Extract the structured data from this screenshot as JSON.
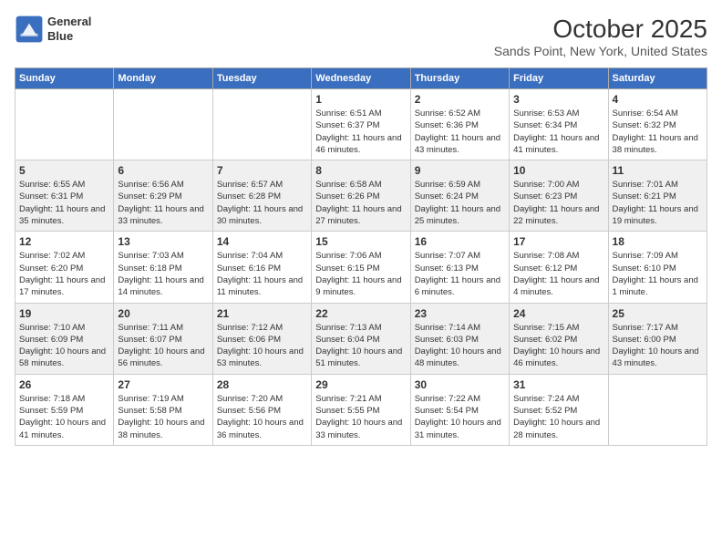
{
  "header": {
    "logo": {
      "line1": "General",
      "line2": "Blue"
    },
    "month": "October 2025",
    "location": "Sands Point, New York, United States"
  },
  "weekdays": [
    "Sunday",
    "Monday",
    "Tuesday",
    "Wednesday",
    "Thursday",
    "Friday",
    "Saturday"
  ],
  "weeks": [
    [
      {
        "day": "",
        "content": ""
      },
      {
        "day": "",
        "content": ""
      },
      {
        "day": "",
        "content": ""
      },
      {
        "day": "1",
        "content": "Sunrise: 6:51 AM\nSunset: 6:37 PM\nDaylight: 11 hours and 46 minutes."
      },
      {
        "day": "2",
        "content": "Sunrise: 6:52 AM\nSunset: 6:36 PM\nDaylight: 11 hours and 43 minutes."
      },
      {
        "day": "3",
        "content": "Sunrise: 6:53 AM\nSunset: 6:34 PM\nDaylight: 11 hours and 41 minutes."
      },
      {
        "day": "4",
        "content": "Sunrise: 6:54 AM\nSunset: 6:32 PM\nDaylight: 11 hours and 38 minutes."
      }
    ],
    [
      {
        "day": "5",
        "content": "Sunrise: 6:55 AM\nSunset: 6:31 PM\nDaylight: 11 hours and 35 minutes."
      },
      {
        "day": "6",
        "content": "Sunrise: 6:56 AM\nSunset: 6:29 PM\nDaylight: 11 hours and 33 minutes."
      },
      {
        "day": "7",
        "content": "Sunrise: 6:57 AM\nSunset: 6:28 PM\nDaylight: 11 hours and 30 minutes."
      },
      {
        "day": "8",
        "content": "Sunrise: 6:58 AM\nSunset: 6:26 PM\nDaylight: 11 hours and 27 minutes."
      },
      {
        "day": "9",
        "content": "Sunrise: 6:59 AM\nSunset: 6:24 PM\nDaylight: 11 hours and 25 minutes."
      },
      {
        "day": "10",
        "content": "Sunrise: 7:00 AM\nSunset: 6:23 PM\nDaylight: 11 hours and 22 minutes."
      },
      {
        "day": "11",
        "content": "Sunrise: 7:01 AM\nSunset: 6:21 PM\nDaylight: 11 hours and 19 minutes."
      }
    ],
    [
      {
        "day": "12",
        "content": "Sunrise: 7:02 AM\nSunset: 6:20 PM\nDaylight: 11 hours and 17 minutes."
      },
      {
        "day": "13",
        "content": "Sunrise: 7:03 AM\nSunset: 6:18 PM\nDaylight: 11 hours and 14 minutes."
      },
      {
        "day": "14",
        "content": "Sunrise: 7:04 AM\nSunset: 6:16 PM\nDaylight: 11 hours and 11 minutes."
      },
      {
        "day": "15",
        "content": "Sunrise: 7:06 AM\nSunset: 6:15 PM\nDaylight: 11 hours and 9 minutes."
      },
      {
        "day": "16",
        "content": "Sunrise: 7:07 AM\nSunset: 6:13 PM\nDaylight: 11 hours and 6 minutes."
      },
      {
        "day": "17",
        "content": "Sunrise: 7:08 AM\nSunset: 6:12 PM\nDaylight: 11 hours and 4 minutes."
      },
      {
        "day": "18",
        "content": "Sunrise: 7:09 AM\nSunset: 6:10 PM\nDaylight: 11 hours and 1 minute."
      }
    ],
    [
      {
        "day": "19",
        "content": "Sunrise: 7:10 AM\nSunset: 6:09 PM\nDaylight: 10 hours and 58 minutes."
      },
      {
        "day": "20",
        "content": "Sunrise: 7:11 AM\nSunset: 6:07 PM\nDaylight: 10 hours and 56 minutes."
      },
      {
        "day": "21",
        "content": "Sunrise: 7:12 AM\nSunset: 6:06 PM\nDaylight: 10 hours and 53 minutes."
      },
      {
        "day": "22",
        "content": "Sunrise: 7:13 AM\nSunset: 6:04 PM\nDaylight: 10 hours and 51 minutes."
      },
      {
        "day": "23",
        "content": "Sunrise: 7:14 AM\nSunset: 6:03 PM\nDaylight: 10 hours and 48 minutes."
      },
      {
        "day": "24",
        "content": "Sunrise: 7:15 AM\nSunset: 6:02 PM\nDaylight: 10 hours and 46 minutes."
      },
      {
        "day": "25",
        "content": "Sunrise: 7:17 AM\nSunset: 6:00 PM\nDaylight: 10 hours and 43 minutes."
      }
    ],
    [
      {
        "day": "26",
        "content": "Sunrise: 7:18 AM\nSunset: 5:59 PM\nDaylight: 10 hours and 41 minutes."
      },
      {
        "day": "27",
        "content": "Sunrise: 7:19 AM\nSunset: 5:58 PM\nDaylight: 10 hours and 38 minutes."
      },
      {
        "day": "28",
        "content": "Sunrise: 7:20 AM\nSunset: 5:56 PM\nDaylight: 10 hours and 36 minutes."
      },
      {
        "day": "29",
        "content": "Sunrise: 7:21 AM\nSunset: 5:55 PM\nDaylight: 10 hours and 33 minutes."
      },
      {
        "day": "30",
        "content": "Sunrise: 7:22 AM\nSunset: 5:54 PM\nDaylight: 10 hours and 31 minutes."
      },
      {
        "day": "31",
        "content": "Sunrise: 7:24 AM\nSunset: 5:52 PM\nDaylight: 10 hours and 28 minutes."
      },
      {
        "day": "",
        "content": ""
      }
    ]
  ]
}
